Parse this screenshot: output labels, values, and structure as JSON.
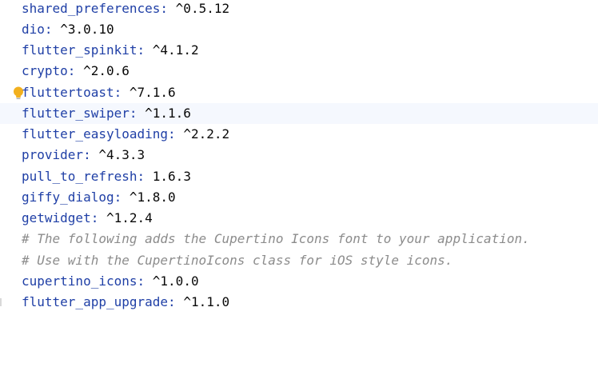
{
  "editor": {
    "dependencies": [
      {
        "name": "shared_preferences",
        "version": "^0.5.12"
      },
      {
        "name": "dio",
        "version": "^3.0.10"
      },
      {
        "name": "flutter_spinkit",
        "version": "^4.1.2"
      },
      {
        "name": "crypto",
        "version": "^2.0.6"
      },
      {
        "name": "fluttertoast",
        "version": "^7.1.6"
      },
      {
        "name": "flutter_swiper",
        "version": "^1.1.6"
      },
      {
        "name": "flutter_easyloading",
        "version": "^2.2.2"
      },
      {
        "name": "provider",
        "version": "^4.3.3"
      },
      {
        "name": "pull_to_refresh",
        "version": "1.6.3"
      },
      {
        "name": "giffy_dialog",
        "version": "^1.8.0"
      },
      {
        "name": "getwidget",
        "version": "^1.2.4"
      }
    ],
    "comments": [
      "# The following adds the Cupertino Icons font to your application.",
      "# Use with the CupertinoIcons class for iOS style icons."
    ],
    "dependencies_after": [
      {
        "name": "cupertino_icons",
        "version": "^1.0.0"
      },
      {
        "name": "flutter_app_upgrade",
        "version": "^1.1.0"
      }
    ],
    "separator": ":",
    "colors": {
      "key": "#1f3fa6",
      "value": "#080808",
      "comment": "#8c8c8c",
      "current_line": "#f5f8fe",
      "bulb": "#f2b01e"
    },
    "intention_icon": "lightbulb-icon"
  }
}
